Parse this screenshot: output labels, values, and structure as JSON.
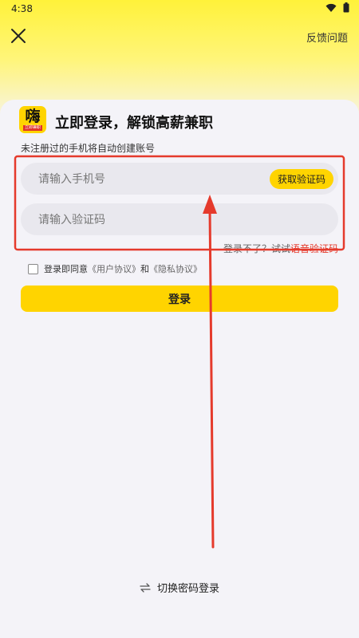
{
  "status": {
    "time": "4:38"
  },
  "header": {
    "feedback": "反馈问题"
  },
  "logo": {
    "char": "嗨",
    "subtext": "立即兼职"
  },
  "title": "立即登录，解锁高薪兼职",
  "subtitle": "未注册过的手机将自动创建账号",
  "phone": {
    "placeholder": "请输入手机号",
    "get_code": "获取验证码"
  },
  "code": {
    "placeholder": "请输入验证码"
  },
  "voice": {
    "prefix": "登录不了？试试",
    "link": "语音验证码"
  },
  "agreement": {
    "prefix": "登录即同意",
    "user_doc": "《用户协议》",
    "and": "和",
    "privacy_doc": "《隐私协议》"
  },
  "login_label": "登录",
  "switch_label": "切换密码登录",
  "colors": {
    "accent": "#ffd400",
    "annotation": "#e53a2c"
  }
}
